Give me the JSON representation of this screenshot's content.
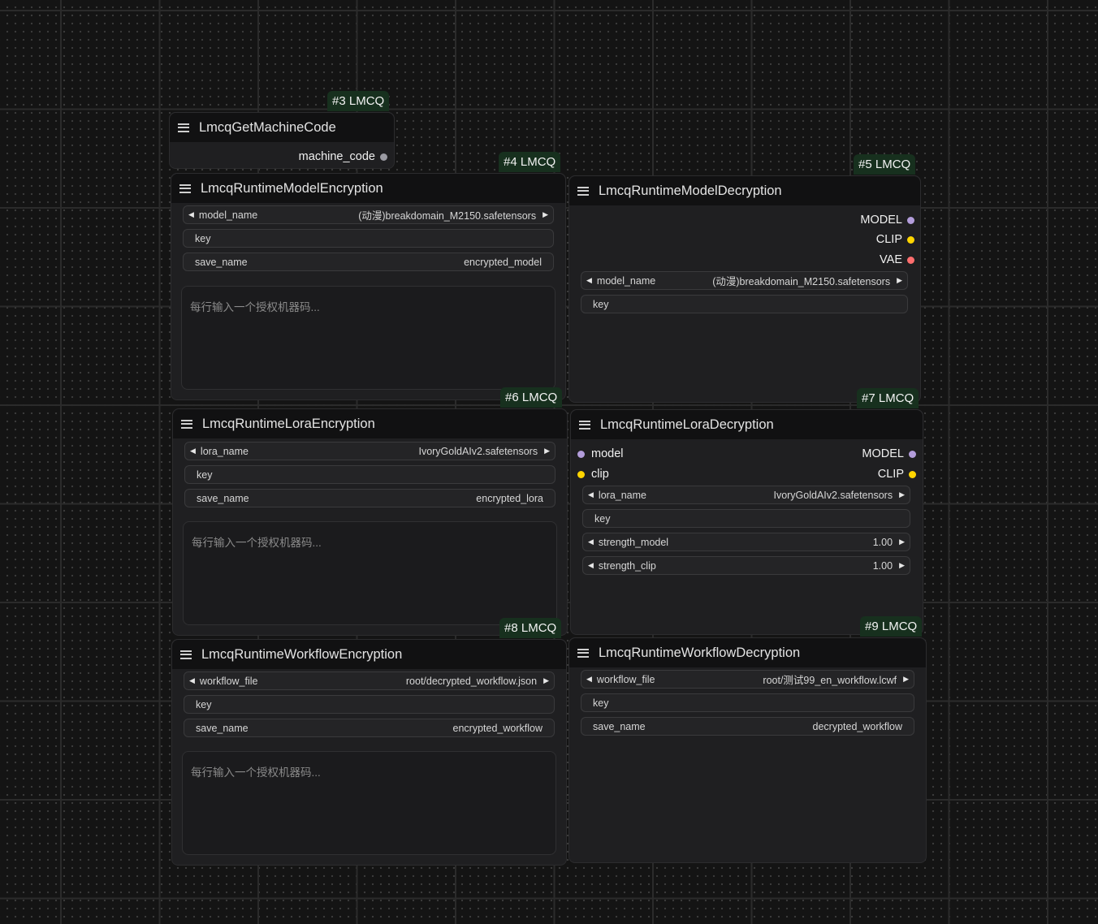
{
  "nodes": {
    "n3": {
      "badge": "#3 LMCQ",
      "title": "LmcqGetMachineCode",
      "outputs": [
        {
          "label": "machine_code",
          "color": "#9a9aa2"
        }
      ]
    },
    "n4": {
      "badge": "#4 LMCQ",
      "title": "LmcqRuntimeModelEncryption",
      "widgets": {
        "model_name": {
          "label": "model_name",
          "value": "(动漫)breakdomain_M2150.safetensors"
        },
        "key": {
          "label": "key"
        },
        "save_name": {
          "label": "save_name",
          "value": "encrypted_model"
        }
      },
      "textarea_placeholder": "每行输入一个授权机器码..."
    },
    "n5": {
      "badge": "#5 LMCQ",
      "title": "LmcqRuntimeModelDecryption",
      "outputs": [
        {
          "label": "MODEL",
          "color": "#b39ddb"
        },
        {
          "label": "CLIP",
          "color": "#ffd500"
        },
        {
          "label": "VAE",
          "color": "#ff6e6e"
        }
      ],
      "widgets": {
        "model_name": {
          "label": "model_name",
          "value": "(动漫)breakdomain_M2150.safetensors"
        },
        "key": {
          "label": "key"
        }
      }
    },
    "n6": {
      "badge": "#6 LMCQ",
      "title": "LmcqRuntimeLoraEncryption",
      "widgets": {
        "lora_name": {
          "label": "lora_name",
          "value": "IvoryGoldAIv2.safetensors"
        },
        "key": {
          "label": "key"
        },
        "save_name": {
          "label": "save_name",
          "value": "encrypted_lora"
        }
      },
      "textarea_placeholder": "每行输入一个授权机器码..."
    },
    "n7": {
      "badge": "#7 LMCQ",
      "title": "LmcqRuntimeLoraDecryption",
      "inputs": [
        {
          "label": "model",
          "color": "#b39ddb"
        },
        {
          "label": "clip",
          "color": "#ffd500"
        }
      ],
      "outputs": [
        {
          "label": "MODEL",
          "color": "#b39ddb"
        },
        {
          "label": "CLIP",
          "color": "#ffd500"
        }
      ],
      "widgets": {
        "lora_name": {
          "label": "lora_name",
          "value": "IvoryGoldAIv2.safetensors"
        },
        "key": {
          "label": "key"
        },
        "strength_model": {
          "label": "strength_model",
          "value": "1.00"
        },
        "strength_clip": {
          "label": "strength_clip",
          "value": "1.00"
        }
      }
    },
    "n8": {
      "badge": "#8 LMCQ",
      "title": "LmcqRuntimeWorkflowEncryption",
      "widgets": {
        "workflow_file": {
          "label": "workflow_file",
          "value": "root/decrypted_workflow.json"
        },
        "key": {
          "label": "key"
        },
        "save_name": {
          "label": "save_name",
          "value": "encrypted_workflow"
        }
      },
      "textarea_placeholder": "每行输入一个授权机器码..."
    },
    "n9": {
      "badge": "#9 LMCQ",
      "title": "LmcqRuntimeWorkflowDecryption",
      "widgets": {
        "workflow_file": {
          "label": "workflow_file",
          "value": "root/测试99_en_workflow.lcwf"
        },
        "key": {
          "label": "key"
        },
        "save_name": {
          "label": "save_name",
          "value": "decrypted_workflow"
        }
      }
    }
  },
  "icons": {
    "menu": "hamburger-icon",
    "combo_prev": "triangle-left-icon",
    "combo_next": "triangle-right-icon",
    "slot": "slot-dot-icon"
  }
}
